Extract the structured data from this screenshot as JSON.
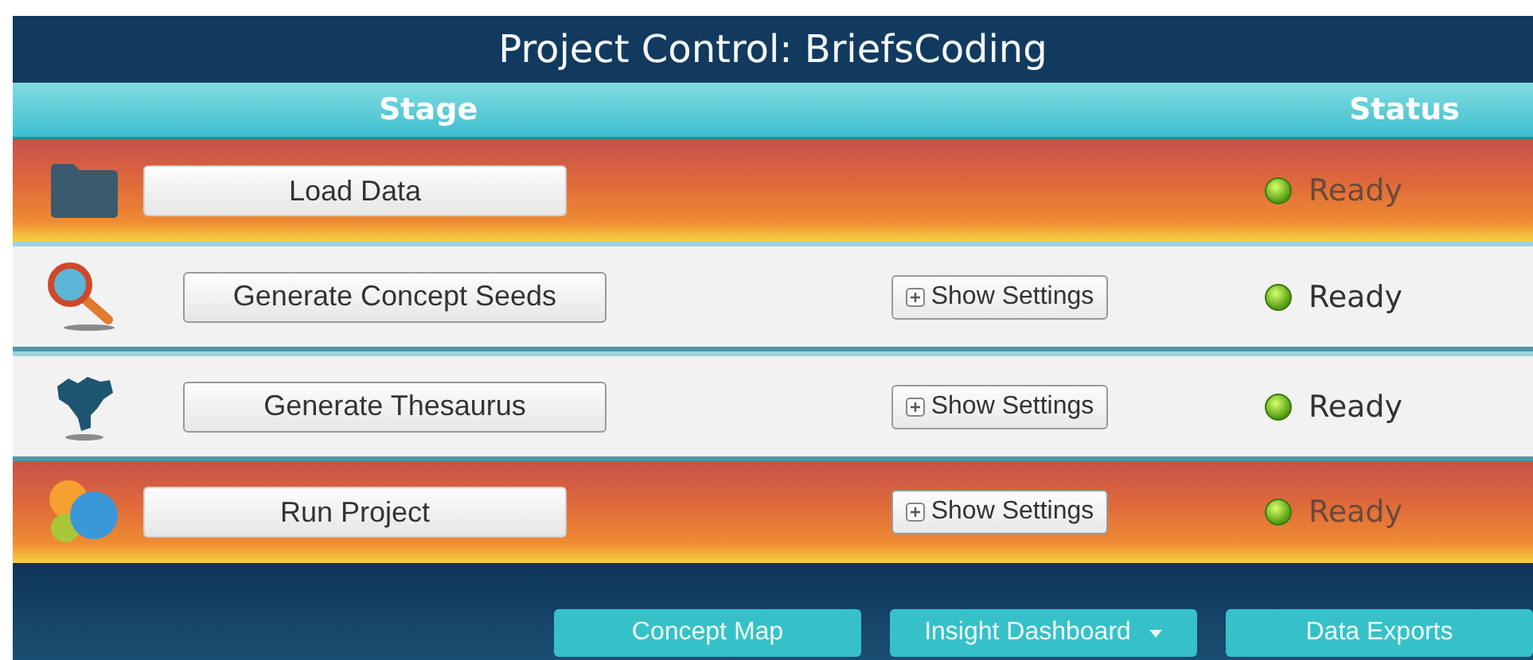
{
  "window": {
    "title": "Project Control: BriefsCoding"
  },
  "columns": [
    "Stage",
    "Status"
  ],
  "stages": [
    {
      "kind": "highlight",
      "action": "Load Data",
      "status": "Ready"
    },
    {
      "kind": "plain",
      "action": "Generate Concept Seeds",
      "settings": "Show Settings",
      "status": "Ready"
    },
    {
      "kind": "plain",
      "action": "Generate Thesaurus",
      "settings": "Show Settings",
      "status": "Ready"
    },
    {
      "kind": "highlight",
      "action": "Run Project",
      "settings": "Show Settings",
      "status": "Ready"
    }
  ],
  "footer_buttons": [
    {
      "label": "Concept Map",
      "dropdown": false
    },
    {
      "label": "Insight Dashboard",
      "dropdown": true
    },
    {
      "label": "Data Exports",
      "dropdown": false
    }
  ]
}
